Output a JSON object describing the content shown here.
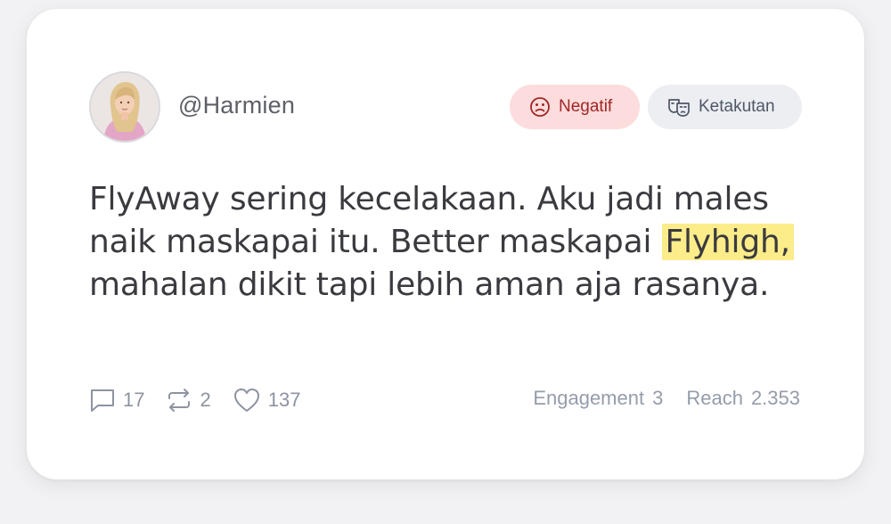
{
  "post": {
    "username": "@Harmien",
    "text_before": "FlyAway sering kecelakaan. Aku jadi males naik maskapai itu. Better maskapai ",
    "text_highlight": "Flyhigh,",
    "text_after": " mahalan dikit tapi lebih aman aja rasanya."
  },
  "badges": {
    "sentiment": {
      "label": "Negatif",
      "icon": "frown-face-icon",
      "color": "#a12626",
      "bg": "#fcdcdc"
    },
    "emotion": {
      "label": "Ketakutan",
      "icon": "theater-masks-icon",
      "color": "#4f5666",
      "bg": "#eceef2"
    }
  },
  "stats": {
    "comments": "17",
    "reposts": "2",
    "likes": "137"
  },
  "metrics": {
    "engagement_label": "Engagement",
    "engagement_value": "3",
    "reach_label": "Reach",
    "reach_value": "2.353"
  },
  "colors": {
    "highlight": "#fcec8a",
    "text": "#3a3a3f",
    "muted": "#8d93a1"
  }
}
